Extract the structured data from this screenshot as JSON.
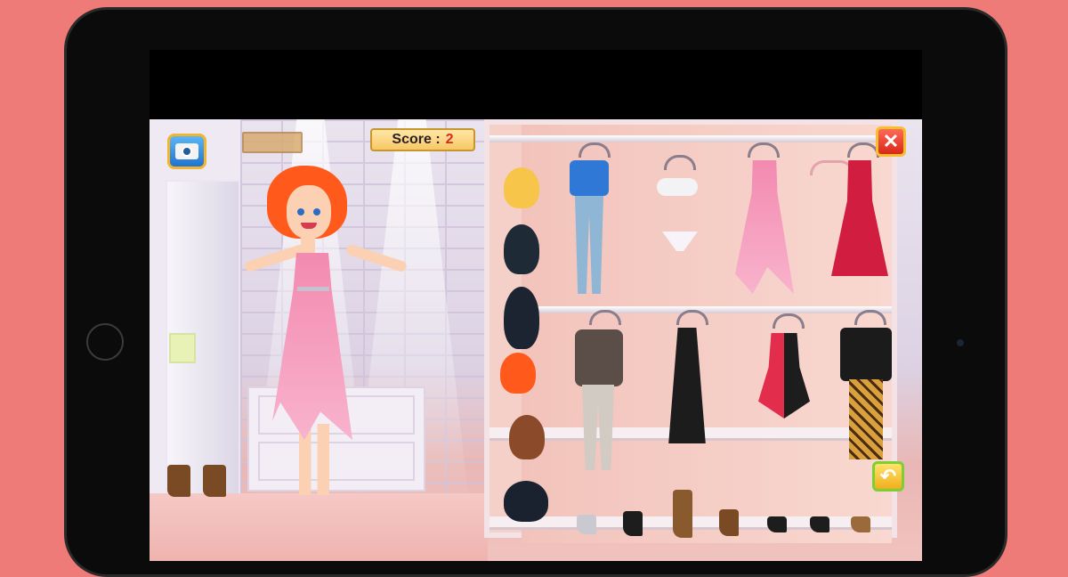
{
  "score": {
    "label": "Score :",
    "value": "2"
  },
  "buttons": {
    "close": "✕",
    "undo": "↶"
  },
  "icons": [
    "camera-icon",
    "close-icon",
    "undo-icon"
  ],
  "colors": {
    "background": "#ee7b78",
    "tablet_frame": "#0b0b0b",
    "score_value": "#d92a1b",
    "hair": "#ff5a1c",
    "dress": "#f38ab0"
  },
  "wardrobe": {
    "hairstyles": [
      "blonde-bob",
      "black-long",
      "black-wavy",
      "orange-curly",
      "brown-short",
      "black-curly"
    ],
    "top_row_outfits": [
      "blue-top-jeans",
      "white-lingerie",
      "pink-dress",
      "red-dress"
    ],
    "middle_row_outfits": [
      "grey-cardigan-pants",
      "black-dress",
      "red-black-swimsuit",
      "black-top-leopard-leggings"
    ],
    "shoes": [
      "grey-heels",
      "black-boots",
      "brown-tall-boots",
      "brown-boots",
      "black-heels",
      "black-sandals",
      "brown-sandals"
    ]
  }
}
